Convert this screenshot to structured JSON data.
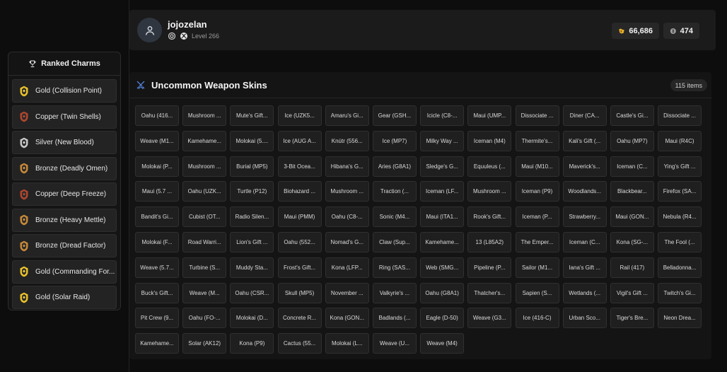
{
  "profile": {
    "username": "jojozelan",
    "level_text": "Level 266",
    "credits": "66,686",
    "renown": "474"
  },
  "sidebar": {
    "title": "Ranked Charms",
    "charms": [
      {
        "label": "Gold (Collision Point)",
        "tier": "gold"
      },
      {
        "label": "Copper (Twin Shells)",
        "tier": "copper"
      },
      {
        "label": "Silver (New Blood)",
        "tier": "silver"
      },
      {
        "label": "Bronze (Deadly Omen)",
        "tier": "bronze"
      },
      {
        "label": "Copper (Deep Freeze)",
        "tier": "copper"
      },
      {
        "label": "Bronze (Heavy Mettle)",
        "tier": "bronze"
      },
      {
        "label": "Bronze (Dread Factor)",
        "tier": "bronze"
      },
      {
        "label": "Gold (Commanding For...",
        "tier": "gold"
      },
      {
        "label": "Gold (Solar Raid)",
        "tier": "gold"
      }
    ]
  },
  "skins_panel": {
    "title": "Uncommon Weapon Skins",
    "count": "115 items",
    "items": [
      "Oahu (416...",
      "Mushroom ...",
      "Mute's Gift...",
      "Ice (UZK5...",
      "Amaru's Gi...",
      "Gear (GSH...",
      "Icicle (C8-...",
      "Maui (UMP...",
      "Dissociate ...",
      "Diner (CA...",
      "Castle's Gi...",
      "Dissociate ...",
      "Weave (M1...",
      "Kamehame...",
      "Molokai (5....",
      "Ice (AUG A...",
      "Knútr (556...",
      "Ice (MP7)",
      "Milky Way ...",
      "Iceman (M4)",
      "Thermite's...",
      "Kali's Gift (...",
      "Oahu (MP7)",
      "Maui (R4C)",
      "Molokai (P...",
      "Mushroom ...",
      "Burial (MP5)",
      "3-Bit Ocea...",
      "Hibana's G...",
      "Aries (G8A1)",
      "Sledge's G...",
      "Equuleus (...",
      "Maui (M10...",
      "Maverick's...",
      "Iceman (C...",
      "Ying's Gift ...",
      "Maui (5.7 ...",
      "Oahu (UZK...",
      "Turtle (P12)",
      "Biohazard ...",
      "Mushroom ...",
      "Traction (...",
      "Iceman (LF...",
      "Mushroom ...",
      "Iceman (P9)",
      "Woodlands...",
      "Blackbear...",
      "Firefox (SA...",
      "Bandit's Gi...",
      "Cubist (OT...",
      "Radio Silen...",
      "Maui (PMM)",
      "Oahu (C8-...",
      "Sonic (M4...",
      "Maui (ITA1...",
      "Rook's Gift...",
      "Iceman (P...",
      "Strawberry...",
      "Maui (GON...",
      "Nebula (R4...",
      "Molokai (F...",
      "Road Warri...",
      "Lion's Gift ...",
      "Oahu (552...",
      "Nomad's G...",
      "Claw (Sup...",
      "Kamehame...",
      "13 (L85A2)",
      "The Emper...",
      "Iceman (C...",
      "Kona (SG-...",
      "The Fool (...",
      "Weave (5.7...",
      "Turbine (S...",
      "Muddy Sta...",
      "Frost's Gift...",
      "Kona (LFP...",
      "Ring (SAS...",
      "Web (SMG...",
      "Pipeline (P...",
      "Sailor (M1...",
      "Iana's Gift ...",
      "Rail (417)",
      "Belladonna...",
      "Buck's Gift...",
      "Weave (M...",
      "Oahu (CSR...",
      "Skull (MP5)",
      "November ...",
      "Valkyrie's ...",
      "Oahu (G8A1)",
      "Thatcher's...",
      "Sapien (S...",
      "Wetlands (...",
      "Vigil's Gift ...",
      "Twitch's Gi...",
      "Pit Crew (9...",
      "Oahu (FO-...",
      "Molokai (D...",
      "Concrete R...",
      "Kona (GON...",
      "Badlands (...",
      "Eagle (D-50)",
      "Weave (G3...",
      "Ice (416-C)",
      "Urban Sco...",
      "Tiger's Bre...",
      "Neon Drea...",
      "Kamehame...",
      "Solar (AK12)",
      "Kona (P9)",
      "Cactus (55...",
      "Molokai (L...",
      "Weave (U...",
      "Weave (M4)"
    ]
  },
  "colors": {
    "gold": "#e8c22a",
    "silver": "#c9c9c9",
    "bronze": "#c8893a",
    "copper": "#b0472f",
    "accent_blue": "#5b8ff0"
  }
}
